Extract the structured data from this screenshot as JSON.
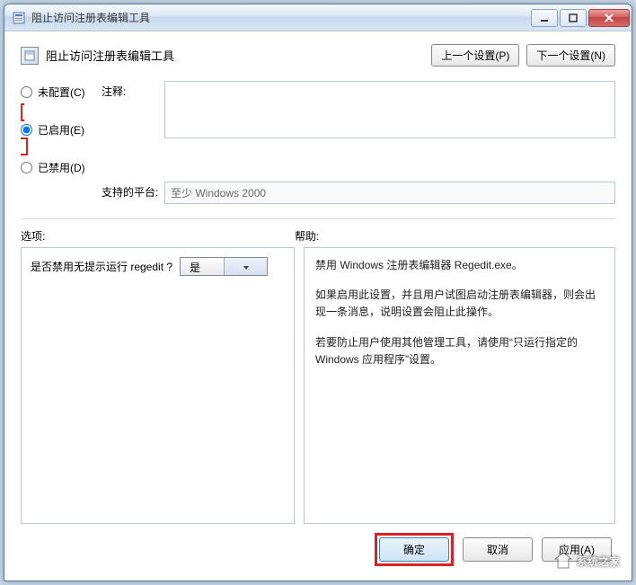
{
  "titlebar": {
    "title": "阻止访问注册表编辑工具"
  },
  "header": {
    "title": "阻止访问注册表编辑工具",
    "prev_btn": "上一个设置(P)",
    "next_btn": "下一个设置(N)"
  },
  "radios": {
    "not_configured": "未配置(C)",
    "enabled": "已启用(E)",
    "disabled": "已禁用(D)"
  },
  "labels": {
    "comment": "注释:",
    "platform": "支持的平台:",
    "options": "选项:",
    "help": "帮助:"
  },
  "comment_value": "",
  "platform_value": "至少 Windows 2000",
  "options": {
    "question": "是否禁用无提示运行 regedit ?",
    "combo_selected": "是"
  },
  "help_text": {
    "p1": "禁用 Windows 注册表编辑器 Regedit.exe。",
    "p2": "如果启用此设置，并且用户试图启动注册表编辑器，则会出现一条消息，说明设置会阻止此操作。",
    "p3": "若要防止用户使用其他管理工具，请使用“只运行指定的 Windows 应用程序”设置。"
  },
  "footer": {
    "ok": "确定",
    "cancel": "取消",
    "apply": "应用(A)"
  },
  "watermark": "系统之家"
}
